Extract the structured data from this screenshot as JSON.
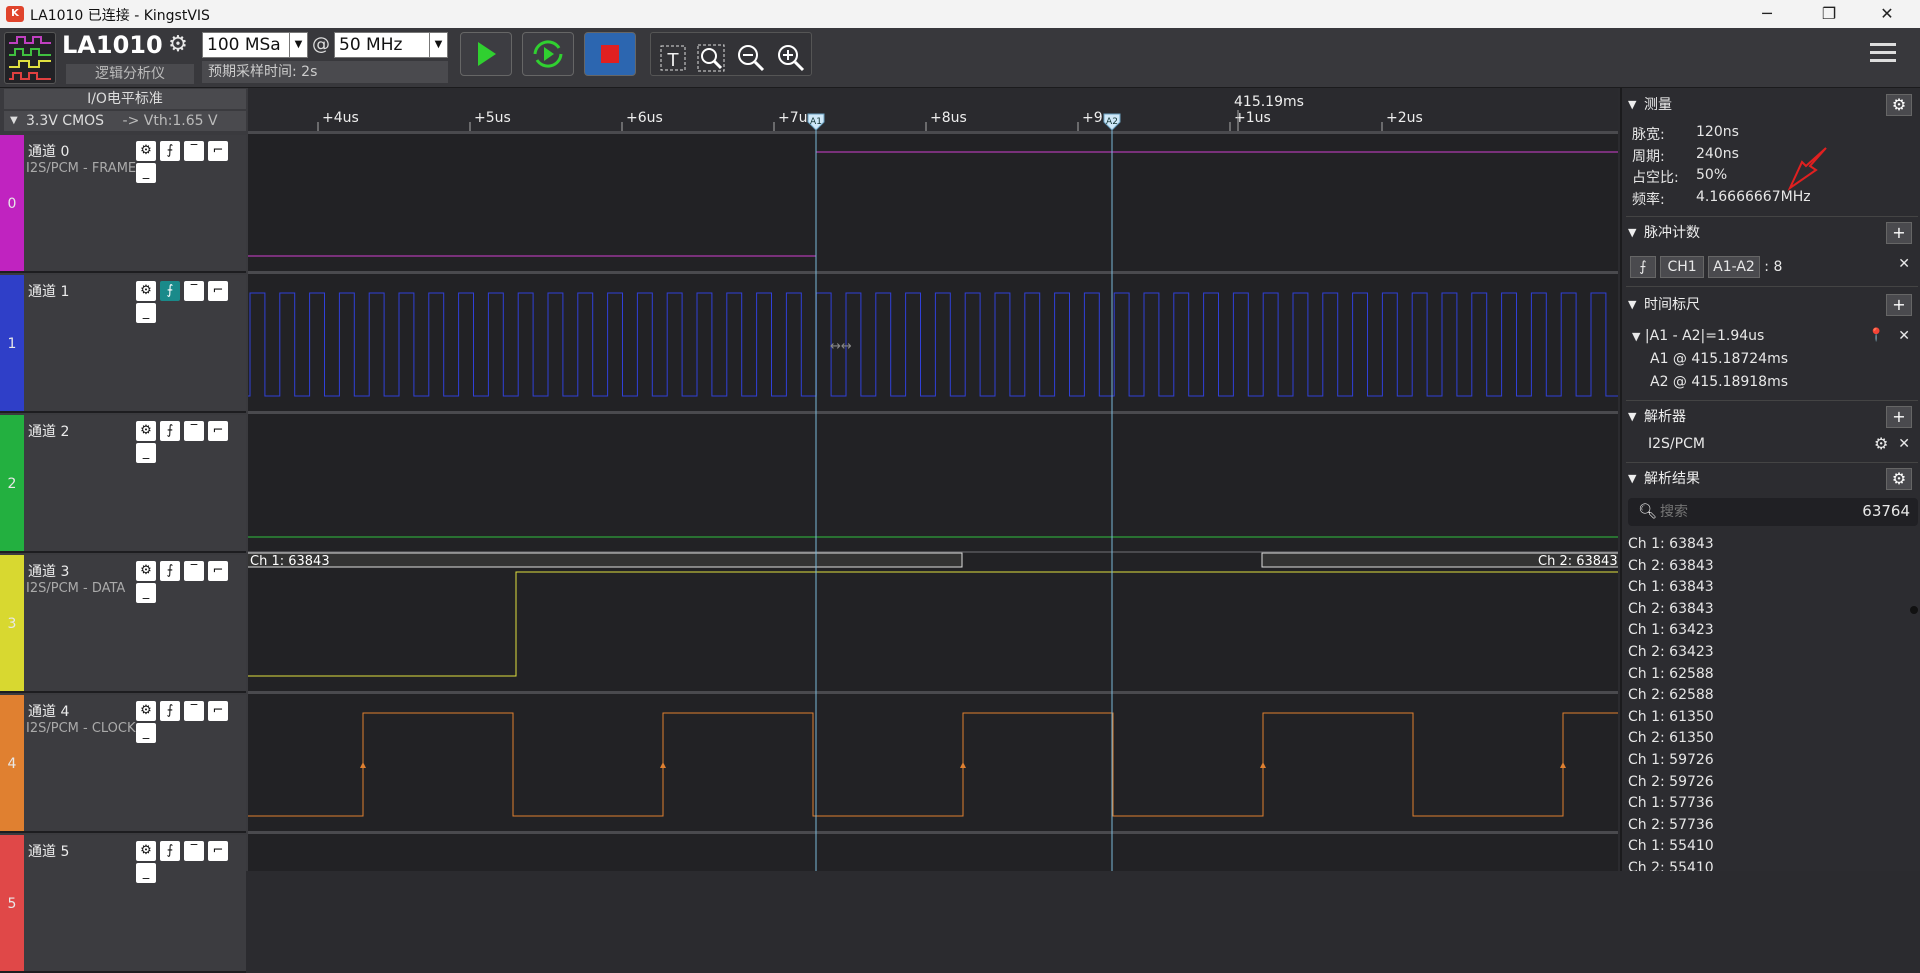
{
  "window": {
    "title": "LA1010 已连接 - KingstVIS",
    "icon_text": "K",
    "minimize": "─",
    "restore": "❐",
    "close": "✕"
  },
  "toolbar": {
    "device_name": "LA1010",
    "device_sub": "逻辑分析仪",
    "sample_rate": "100 MSa",
    "at": "@",
    "sample_freq": "50 MHz",
    "sample_time": "预期采样时间: 2s"
  },
  "left": {
    "io_title": "I/O电平标准",
    "io_value": "3.3V CMOS",
    "vth": "-> Vth:1.65 V"
  },
  "channels": [
    {
      "num": "0",
      "name": "通道 0",
      "sub": "I2S/PCM - FRAME",
      "color": "#c023c0"
    },
    {
      "num": "1",
      "name": "通道 1",
      "sub": "",
      "color": "#2f3fc8"
    },
    {
      "num": "2",
      "name": "通道 2",
      "sub": "",
      "color": "#23b040"
    },
    {
      "num": "3",
      "name": "通道 3",
      "sub": "I2S/PCM - DATA",
      "color": "#d8d830"
    },
    {
      "num": "4",
      "name": "通道 4",
      "sub": "I2S/PCM - CLOCK",
      "color": "#e08030"
    },
    {
      "num": "5",
      "name": "通道 5",
      "sub": "",
      "color": "#e04848"
    }
  ],
  "time_axis": {
    "center": "415.19ms",
    "ticks": [
      "+4us",
      "+5us",
      "+6us",
      "+7us",
      "+8us",
      "+9us",
      "+1us",
      "+2us"
    ],
    "marker_a1": "A1",
    "marker_a2": "A2"
  },
  "decode_labels": {
    "left": "Ch 1: 63843",
    "right": "Ch 2: 63843"
  },
  "right": {
    "measure": {
      "title": "测量",
      "pulse_width_label": "脉宽:",
      "pulse_width": "120ns",
      "period_label": "周期:",
      "period": "240ns",
      "duty_label": "占空比:",
      "duty": "50%",
      "freq_label": "频率:",
      "freq": "4.16666667MHz"
    },
    "pulse_count": {
      "title": "脉冲计数",
      "channel": "CH1",
      "range": "A1-A2",
      "count": ": 8"
    },
    "time_marker": {
      "title": "时间标尺",
      "diff": "|A1 - A2|=1.94us",
      "a1": "A1 @ 415.18724ms",
      "a2": "A2 @ 415.18918ms"
    },
    "decoder": {
      "title": "解析器",
      "name": "I2S/PCM"
    },
    "results": {
      "title": "解析结果",
      "search_placeholder": "搜索",
      "count": "63764",
      "items": [
        "Ch 1: 63843",
        "Ch 2: 63843",
        "Ch 1: 63843",
        "Ch 2: 63843",
        "Ch 1: 63423",
        "Ch 2: 63423",
        "Ch 1: 62588",
        "Ch 2: 62588",
        "Ch 1: 61350",
        "Ch 2: 61350",
        "Ch 1: 59726",
        "Ch 2: 59726",
        "Ch 1: 57736",
        "Ch 2: 57736",
        "Ch 1: 55410",
        "Ch 2: 55410"
      ]
    }
  }
}
